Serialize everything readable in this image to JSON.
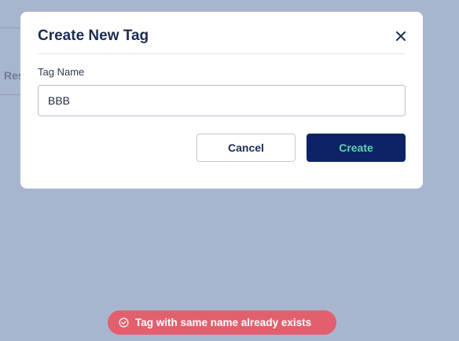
{
  "background": {
    "partial_tab_text": "Res"
  },
  "modal": {
    "title": "Create New Tag",
    "close_icon": "close-icon",
    "field_label": "Tag Name",
    "tag_name_value": "BBB",
    "cancel_label": "Cancel",
    "create_label": "Create"
  },
  "toast": {
    "icon": "check-circle-icon",
    "message": "Tag with same name already exists"
  },
  "colors": {
    "overlay": "#a8b5cf",
    "primary": "#0c2466",
    "primary_text": "#5fd3b3",
    "error": "#e2606e"
  }
}
